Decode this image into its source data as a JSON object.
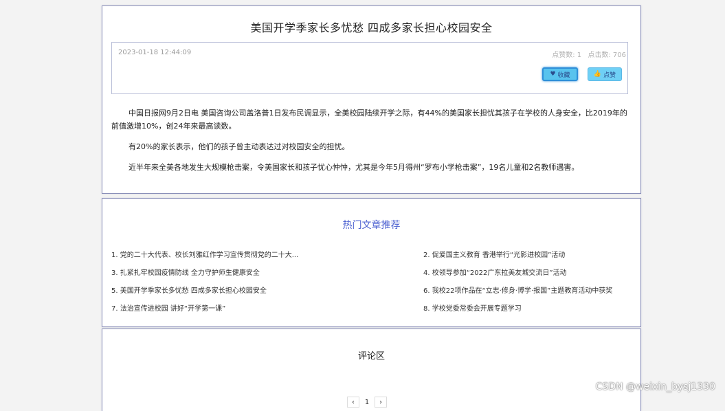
{
  "article": {
    "title": "美国开学季家长多忧愁 四成多家长担心校园安全",
    "date": "2023-01-18 12:44:09",
    "likes_label": "点赞数: 1",
    "clicks_label": "点击数: 706",
    "collect_label": "收藏",
    "collect_icon": "heart-icon",
    "like_label": "点赞",
    "like_icon": "thumbs-up-icon",
    "paragraphs": [
      "中国日报网9月2日电 美国咨询公司盖洛普1日发布民调显示，全美校园陆续开学之际，有44%的美国家长担忧其孩子在学校的人身安全，比2019年的前值激增10%，创24年来最高读数。",
      "有20%的家长表示，他们的孩子曾主动表达过对校园安全的担忧。",
      "近半年来全美各地发生大规模枪击案，令美国家长和孩子忧心忡忡，尤其是今年5月得州“罗布小学枪击案”，19名儿童和2名教师遇害。"
    ]
  },
  "hot": {
    "title": "热门文章推荐",
    "items": [
      "1. 党的二十大代表、校长刘雅红作学习宣传贯彻党的二十大...",
      "2. 促爱国主义教育 香港举行“光影进校园”活动",
      "3. 扎紧扎牢校园疫情防线 全力守护师生健康安全",
      "4. 校领导参加“2022广东拉美友城交流日”活动",
      "5. 美国开学季家长多忧愁 四成多家长担心校园安全",
      "6. 我校22项作品在“立志·修身·博学·报国”主题教育活动中获奖",
      "7. 法治宣传进校园 讲好“开学第一课”",
      "8. 学校党委常委会开展专题学习"
    ]
  },
  "comments": {
    "title": "评论区",
    "pager": {
      "prev": "‹",
      "current": "1",
      "next": "›"
    }
  },
  "watermark": "CSDN @weixin_bysj1330"
}
